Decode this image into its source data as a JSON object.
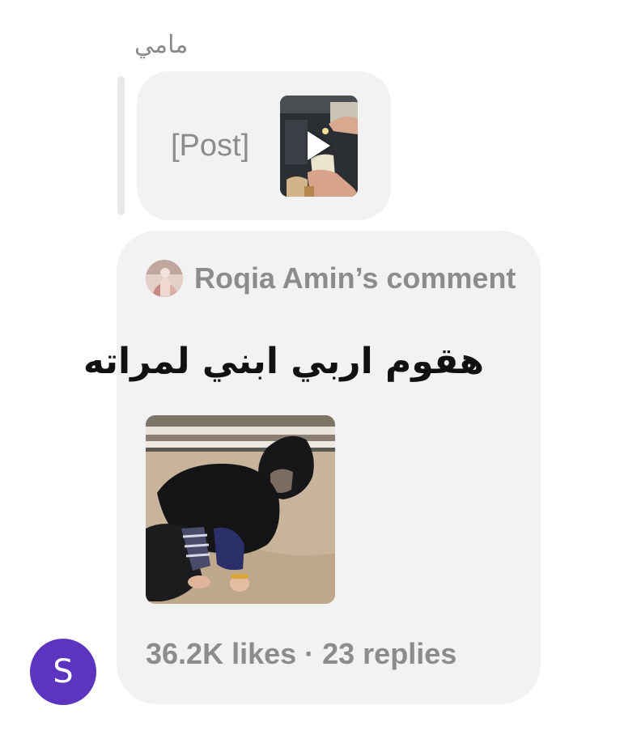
{
  "colors": {
    "page_background": "#ffffff",
    "bubble_background": "#f2f2f2",
    "muted_text": "#8c8c8c",
    "primary_text": "#111111",
    "user_avatar_background": "#5b34c0"
  },
  "reply": {
    "sender_name": "مامي",
    "quoted_post_label": "[Post]",
    "quoted_thumbnail_icon": "play-icon"
  },
  "comment_card": {
    "title": "Roqia Amin’s comment",
    "text": "هقوم اربي ابني لمراته",
    "stats": "36.2K likes · 23 replies"
  },
  "user": {
    "avatar_initial": "S"
  }
}
